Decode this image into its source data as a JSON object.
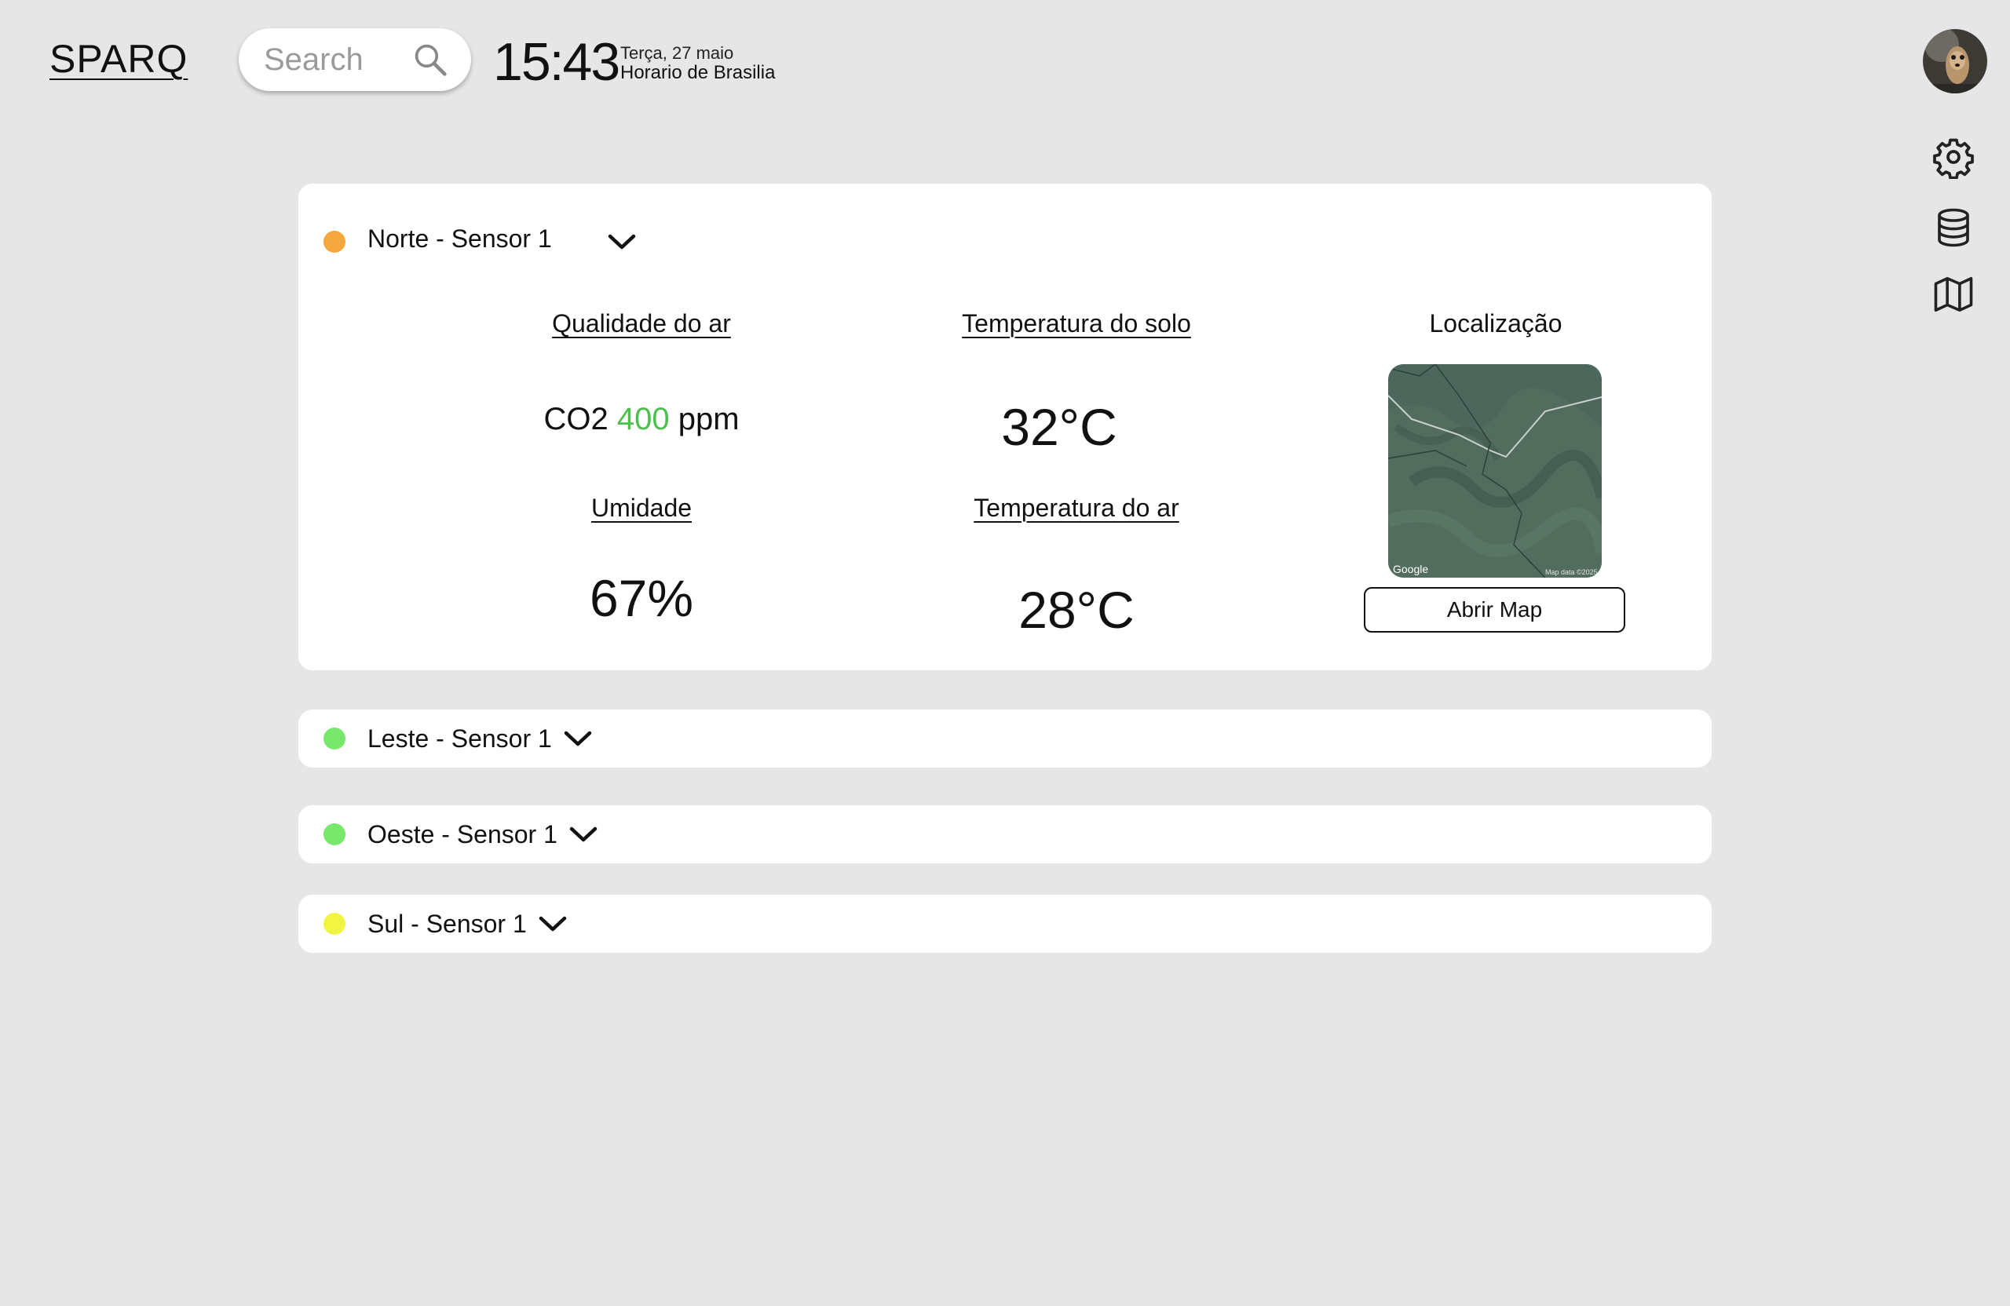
{
  "app": {
    "name": "SPARQ"
  },
  "search": {
    "placeholder": "Search"
  },
  "clock": {
    "time": "15:43",
    "date": "Terça, 27 maio",
    "timezone": "Horario de Brasilia"
  },
  "sidebar": {
    "icons": [
      "gear-icon",
      "database-icon",
      "map-icon"
    ]
  },
  "sensors": [
    {
      "name": "Norte - Sensor 1",
      "status_color": "#f5a63d",
      "expanded": true,
      "air_quality": {
        "label": "Qualidade do ar",
        "prefix": "CO2",
        "value": "400",
        "unit": "ppm",
        "value_color": "#4cbf4c"
      },
      "soil_temp": {
        "label": "Temperatura do solo",
        "value": "32°C"
      },
      "humidity": {
        "label": "Umidade",
        "value": "67%"
      },
      "air_temp": {
        "label": "Temperatura do ar",
        "value": "28°C"
      },
      "location": {
        "label": "Localização",
        "map_credit": "Google",
        "map_data": "Map data ©2025",
        "button_label": "Abrir Map"
      }
    },
    {
      "name": "Leste - Sensor 1",
      "status_color": "#77e86b",
      "expanded": false
    },
    {
      "name": "Oeste - Sensor 1",
      "status_color": "#77e86b",
      "expanded": false
    },
    {
      "name": "Sul - Sensor 1",
      "status_color": "#f1f541",
      "expanded": false
    }
  ]
}
